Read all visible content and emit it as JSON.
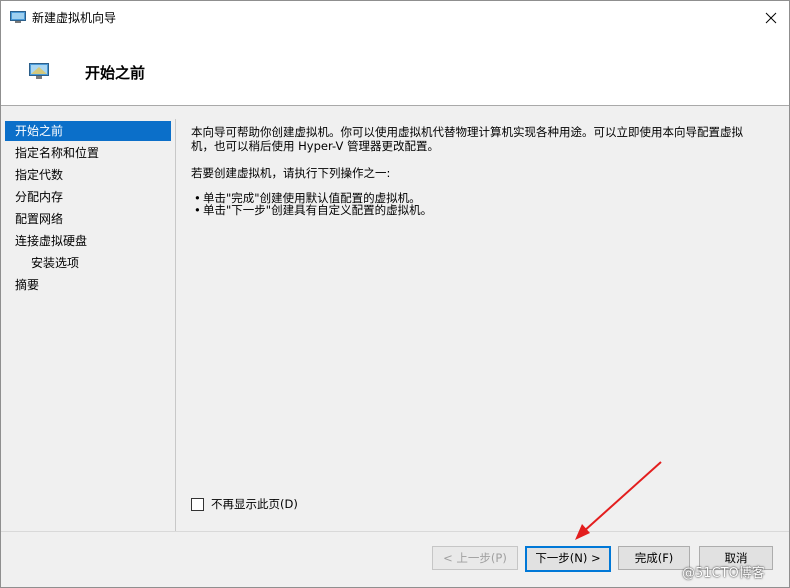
{
  "window": {
    "title": "新建虚拟机向导",
    "close_icon": "close-icon",
    "monitor_icon": "monitor-icon"
  },
  "header": {
    "title": "开始之前"
  },
  "sidebar": {
    "items": [
      {
        "label": "开始之前",
        "active": true
      },
      {
        "label": "指定名称和位置"
      },
      {
        "label": "指定代数"
      },
      {
        "label": "分配内存"
      },
      {
        "label": "配置网络"
      },
      {
        "label": "连接虚拟硬盘"
      },
      {
        "label": "安装选项"
      },
      {
        "label": "摘要"
      }
    ]
  },
  "content": {
    "intro_line1": "本向导可帮助你创建虚拟机。你可以使用虚拟机代替物理计算机实现各种用途。可以立即使用本向导配置虚拟",
    "intro_line2": "机，也可以稍后使用 Hyper-V 管理器更改配置。",
    "prompt": "若要创建虚拟机，请执行下列操作之一:",
    "bullets": [
      "单击\"完成\"创建使用默认值配置的虚拟机。",
      "单击\"下一步\"创建具有自定义配置的虚拟机。"
    ]
  },
  "checkbox": {
    "label": "不再显示此页(D)",
    "checked": false
  },
  "buttons": {
    "prev": "< 上一步(P)",
    "next": "下一步(N) >",
    "finish": "完成(F)",
    "cancel": "取消"
  },
  "annotation": {
    "arrow_color": "#e31e1e"
  },
  "watermark": "@51CTO博客"
}
